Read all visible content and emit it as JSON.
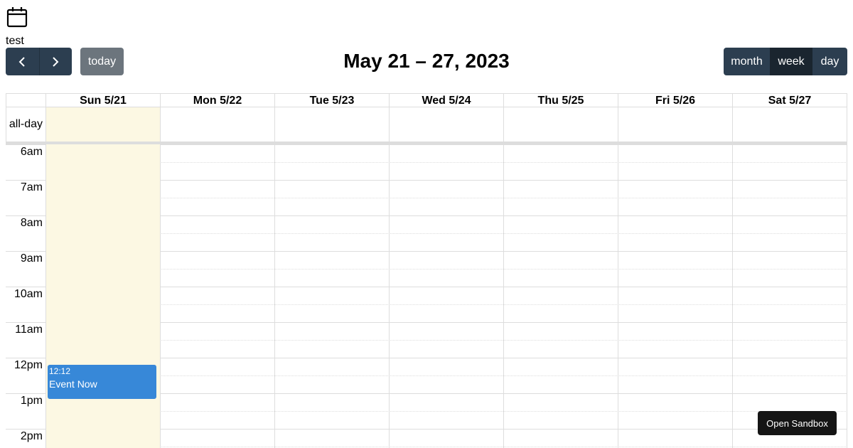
{
  "app": {
    "icon": "calendar-icon",
    "label": "test"
  },
  "toolbar": {
    "prev_icon": "chevron-left-icon",
    "next_icon": "chevron-right-icon",
    "today_label": "today",
    "title": "May 21 – 27, 2023",
    "views": [
      {
        "label": "month",
        "active": false
      },
      {
        "label": "week",
        "active": true
      },
      {
        "label": "day",
        "active": false
      }
    ]
  },
  "calendar": {
    "days": [
      "Sun 5/21",
      "Mon 5/22",
      "Tue 5/23",
      "Wed 5/24",
      "Thu 5/25",
      "Fri 5/26",
      "Sat 5/27"
    ],
    "today_index": 0,
    "allday_label": "all-day",
    "hours": [
      "6am",
      "7am",
      "8am",
      "9am",
      "10am",
      "11am",
      "12pm",
      "1pm",
      "2pm"
    ],
    "events": [
      {
        "time": "12:12",
        "title": "Event Now",
        "day": "Sun 5/21",
        "color": "#3788d8"
      }
    ]
  },
  "colors": {
    "primary": "#2c3e50",
    "today_bg": "#fcf8e3",
    "event": "#3788d8"
  },
  "sandbox": {
    "label": "Open Sandbox"
  }
}
